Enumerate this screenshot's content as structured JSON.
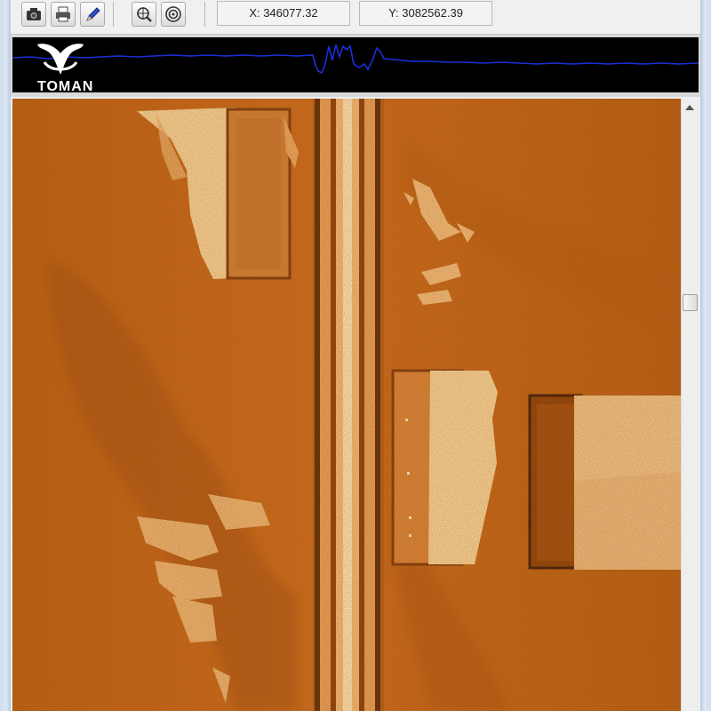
{
  "toolbar": {
    "buttons": [
      {
        "icon": "camera-icon"
      },
      {
        "icon": "printer-icon"
      },
      {
        "icon": "pen-icon"
      },
      {
        "icon": "zoom-crosshair-icon"
      },
      {
        "icon": "target-icon"
      }
    ],
    "x_coordinate": "X: 346077.32",
    "y_coordinate": "Y: 3082562.39"
  },
  "signal_strip": {
    "logo_text": "TOMAN",
    "logo_icon": "whale-tail-icon",
    "trace_color": "#1a2fd6"
  },
  "colors": {
    "sonar_base": "#c66414",
    "sonar_bright": "#f5cf96",
    "sonar_dark": "#6a2c08"
  }
}
